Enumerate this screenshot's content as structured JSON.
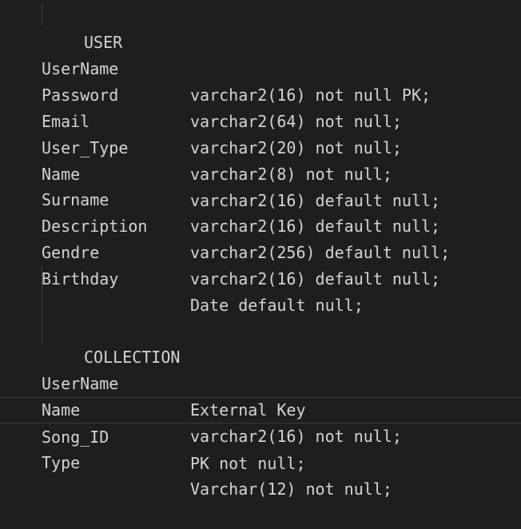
{
  "user": {
    "heading": "USER",
    "rows": [
      {
        "field": "UserName",
        "def": "varchar2(16) not null PK;"
      },
      {
        "field": "Password",
        "def": "varchar2(64) not null;"
      },
      {
        "field": "Email",
        "def": "varchar2(20) not null;"
      },
      {
        "field": "User_Type",
        "def": "varchar2(8) not null;"
      },
      {
        "field": "Name",
        "def": "varchar2(16) default null;"
      },
      {
        "field": "Surname",
        "def": "varchar2(16) default null;"
      },
      {
        "field": "Description",
        "def": "varchar2(256) default null;"
      },
      {
        "field": "Gendre",
        "def": "varchar2(16) default null;"
      },
      {
        "field": "Birthday",
        "def": "Date default null;"
      }
    ]
  },
  "collection": {
    "heading": "COLLECTION",
    "rows": [
      {
        "field": "UserName",
        "def": "External Key"
      },
      {
        "field": "Name",
        "def": "varchar2(16) not null;"
      },
      {
        "field": "Song_ID",
        "def": "PK not null;"
      },
      {
        "field": "Type",
        "def": "Varchar(12) not null;"
      }
    ]
  }
}
